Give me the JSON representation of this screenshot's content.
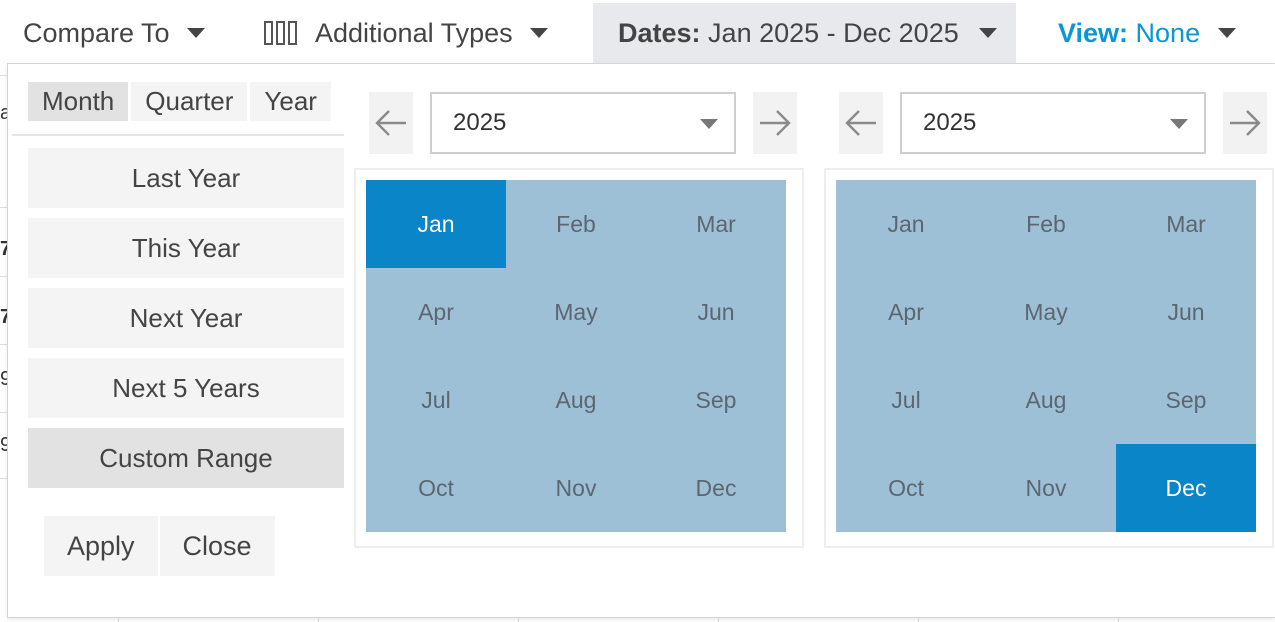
{
  "toolbar": {
    "compare_label": "Compare To",
    "types_label": "Additional Types",
    "dates_prefix": "Dates:",
    "dates_value": "Jan 2025 - Dec 2025",
    "view_prefix": "View:",
    "view_value": "None"
  },
  "background_fragments": [
    "a",
    "7",
    "7",
    "9",
    "9"
  ],
  "granularity_tabs": [
    "Month",
    "Quarter",
    "Year"
  ],
  "active_granularity": "Month",
  "presets": [
    "Last Year",
    "This Year",
    "Next Year",
    "Next 5 Years",
    "Custom Range"
  ],
  "selected_preset": "Custom Range",
  "actions": {
    "apply_label": "Apply",
    "close_label": "Close"
  },
  "calendars": {
    "start": {
      "year": "2025",
      "selected_month": "Jan"
    },
    "end": {
      "year": "2025",
      "selected_month": "Dec"
    }
  },
  "months": [
    "Jan",
    "Feb",
    "Mar",
    "Apr",
    "May",
    "Jun",
    "Jul",
    "Aug",
    "Sep",
    "Oct",
    "Nov",
    "Dec"
  ],
  "colors": {
    "accent_link": "#0a96d8",
    "selected_month_bg": "#0a85c8",
    "month_grid_bg": "#9ec0d7",
    "dates_tab_bg": "#e8e9ec"
  }
}
